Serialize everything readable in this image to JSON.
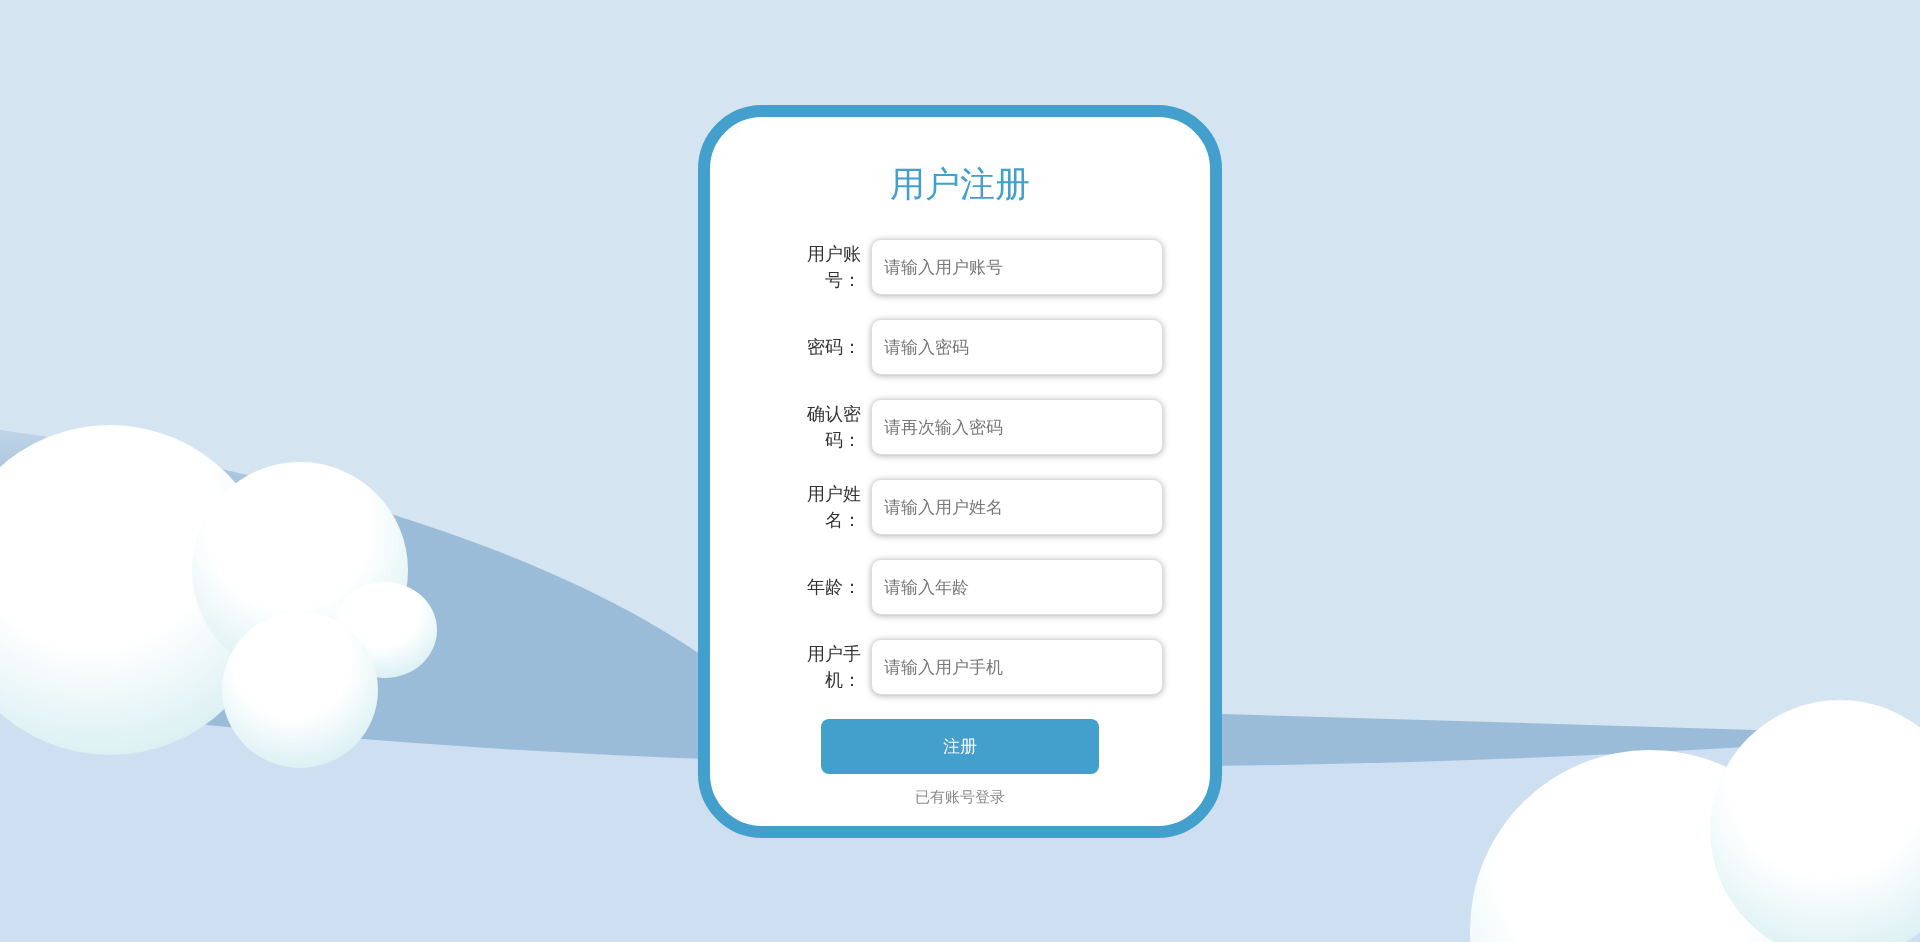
{
  "title": "用户注册",
  "fields": [
    {
      "label": "用户账号：",
      "placeholder": "请输入用户账号"
    },
    {
      "label": "密码：",
      "placeholder": "请输入密码"
    },
    {
      "label": "确认密码：",
      "placeholder": "请再次输入密码"
    },
    {
      "label": "用户姓名：",
      "placeholder": "请输入用户姓名"
    },
    {
      "label": "年龄：",
      "placeholder": "请输入年龄"
    },
    {
      "label": "用户手机：",
      "placeholder": "请输入用户手机"
    }
  ],
  "submit": "注册",
  "login_link": "已有账号登录"
}
